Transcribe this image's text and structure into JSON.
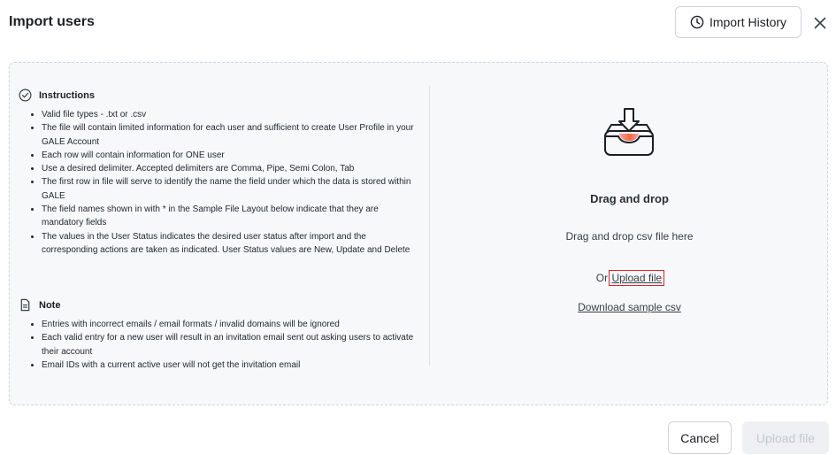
{
  "header": {
    "title": "Import users",
    "history_label": "Import History",
    "history_icon": "clock-icon",
    "close_icon": "close-icon"
  },
  "instructions": {
    "heading": "Instructions",
    "icon": "check-circle-icon",
    "items": [
      "Valid file types - .txt or .csv",
      "The file will contain limited information for each user and sufficient to create User Profile in your GALE Account",
      "Each row will contain information for ONE user",
      "Use a desired delimiter. Accepted delimiters are Comma, Pipe, Semi Colon, Tab",
      "The first row in file will serve to identify the name the field under which the data is stored within GALE",
      "The field names shown in with * in the Sample File Layout below indicate that they are mandatory fields",
      "The values in the User Status indicates the desired user status after import and the corresponding actions are taken as indicated. User Status values are New, Update and Delete"
    ]
  },
  "note": {
    "heading": "Note",
    "icon": "document-icon",
    "items": [
      "Entries with incorrect emails / email formats / invalid domains will be ignored",
      "Each valid entry for a new user will result in an invitation email sent out asking users to activate their account",
      "Email IDs with a current active user will not get the invitation email"
    ]
  },
  "dropzone": {
    "icon": "inbox-download-icon",
    "title": "Drag and drop",
    "subtitle": "Drag and drop csv file here",
    "or_text": "Or",
    "upload_link": "Upload file",
    "sample_link": "Download sample csv"
  },
  "footer": {
    "cancel_label": "Cancel",
    "upload_label": "Upload file"
  },
  "colors": {
    "accent_orange": "#f26b3a",
    "accent_pink": "#f7a3b8",
    "disabled_bg": "#eef0f3",
    "disabled_text": "#c3c8ce"
  }
}
